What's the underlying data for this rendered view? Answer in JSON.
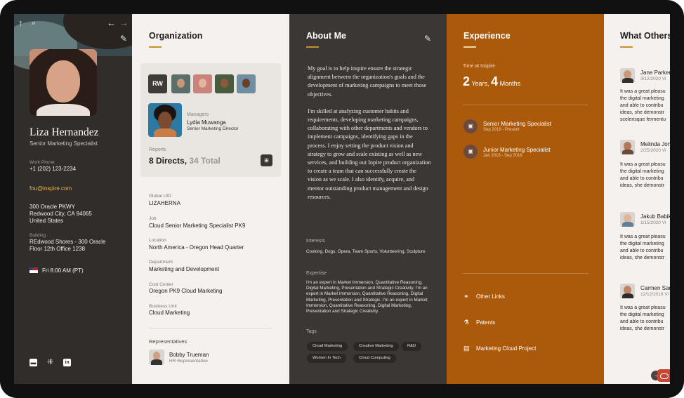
{
  "colors": {
    "profile_bg": "#312d2a",
    "org_bg": "#f4f1ee",
    "about_bg": "#3b3734",
    "experience_bg": "#ab5a0b",
    "accent_underline": "#c8902d",
    "link": "#e6b75c"
  },
  "profile": {
    "name": "Liza Hernandez",
    "title": "Senior Marketing Specialist",
    "work_phone_label": "Work Phone",
    "work_phone": "+1 (202) 123-2234",
    "email": "fnu@inspire.com",
    "address_lines": [
      "300 Oracle PKWY",
      "Redwood City, CA 94065",
      "United States"
    ],
    "building_label": "Building",
    "building_lines": [
      "REdwood Shores - 300 Oracle",
      "Floor 12th Office 1238"
    ],
    "local_time": "Fri 8:00 AM (PT)",
    "icons": [
      "up-arrow-icon",
      "search-icon",
      "back-arrow-icon",
      "forward-arrow-icon",
      "pencil-icon",
      "flag-icon",
      "email-icon",
      "slack-icon",
      "linkedin-icon"
    ]
  },
  "organization": {
    "title": "Organization",
    "team_initials": "RW",
    "managers_label": "Managers",
    "manager_name": "Lydia Muwanga",
    "manager_title": "Senior Marketing Director",
    "reports_label": "Reports",
    "reports_directs": "8 Directs,",
    "reports_total": "34 Total",
    "fields": [
      {
        "label": "Global UID",
        "value": "LIZAHERNA"
      },
      {
        "label": "Job",
        "value": "Cloud Senior Marketing Specialist PK9"
      },
      {
        "label": "Location",
        "value": "North America - Oregon Head Quarter"
      },
      {
        "label": "Department",
        "value": "Marketing and Development"
      },
      {
        "label": "Cost Center",
        "value": "Oregon PK9 Cloud Marketing"
      },
      {
        "label": "Business Unit",
        "value": "Cloud Marketing"
      }
    ],
    "representatives_label": "Representatives",
    "rep_name": "Bobby Trueman",
    "rep_title": "HR Representative"
  },
  "about": {
    "title": "About Me",
    "paragraph1": "My goal is to help inspire ensure the strategic alignment between the organization's goals and the development of marketing campaigns to meet those objectives.",
    "paragraph2": "I'm skilled at analyzing customer habits and requirements, developing marketing campaigns, collaborating with other departments and vendors to implement campaigns, identifying gaps in the process. I enjoy setting the product vision and strategy to grow and scale existing as well as new services, and building out Inpire product organization to create a team that can successfully create the vision as we scale. I also identify, acquire, and mentor outstanding product management and design resources.",
    "interests_label": "Interests",
    "interests": "Cooking, Dogs, Opera, Team Sports, Volunteering, Sculpture",
    "expertise_label": "Expertise",
    "expertise": "I'm an expert in Market Immersion, Quantitative Reasoning, Digital Marketing, Presentation and Strategic Creativity. I'm an expert in Market Immersion, Quantitative Reasoning, Digital Marketing, Presentation and Strategic. I'm an expert in Market Immersion, Quantitative Reasoning, Digital Marketing, Presentation and Strategic Creativity.",
    "tags_label": "Tags",
    "tags": [
      "Cloud Marketing",
      "Creative Marketing",
      "R&D",
      "Women In Tech",
      "Cloud Computing"
    ]
  },
  "experience": {
    "title": "Experience",
    "time_label": "Time at Inspire",
    "years_num": "2",
    "years_unit": "Years,",
    "months_num": "4",
    "months_unit": "Months",
    "jobs": [
      {
        "title": "Senior Marketing Specialist",
        "dates": "Sep 2018 - Present"
      },
      {
        "title": "Junior Marketing Specialist",
        "dates": "Jan 2018 - Sep 2018"
      }
    ],
    "links": [
      "Other Links",
      "Patents",
      "Marketing Cloud Project"
    ]
  },
  "others": {
    "title": "What Others",
    "entries": [
      {
        "name": "Jane Parker",
        "date": "3/12/2020 Vi",
        "lines": [
          "It was a great pleasu",
          "the digital marketing",
          "and able to contribu",
          "ideas, she demonstr",
          "scelerisque fermentu"
        ]
      },
      {
        "name": "Melinda Jon",
        "date": "2/25/2020 Vi",
        "lines": [
          "It was a great pleasu",
          "the digital marketing",
          "and able to contribu",
          "ideas, she demonstr"
        ]
      },
      {
        "name": "Jakub Babik",
        "date": "1/15/2020 Vi",
        "lines": [
          "It was a great pleasu",
          "the digital marketing",
          "and able to contribu",
          "ideas, she demonstr"
        ]
      },
      {
        "name": "Carmen San",
        "date": "12/12/2019 Vi",
        "lines": [
          "It was a great pleasu",
          "the digital marketing",
          "and able to contribu",
          "ideas, she demonstr"
        ]
      }
    ]
  }
}
